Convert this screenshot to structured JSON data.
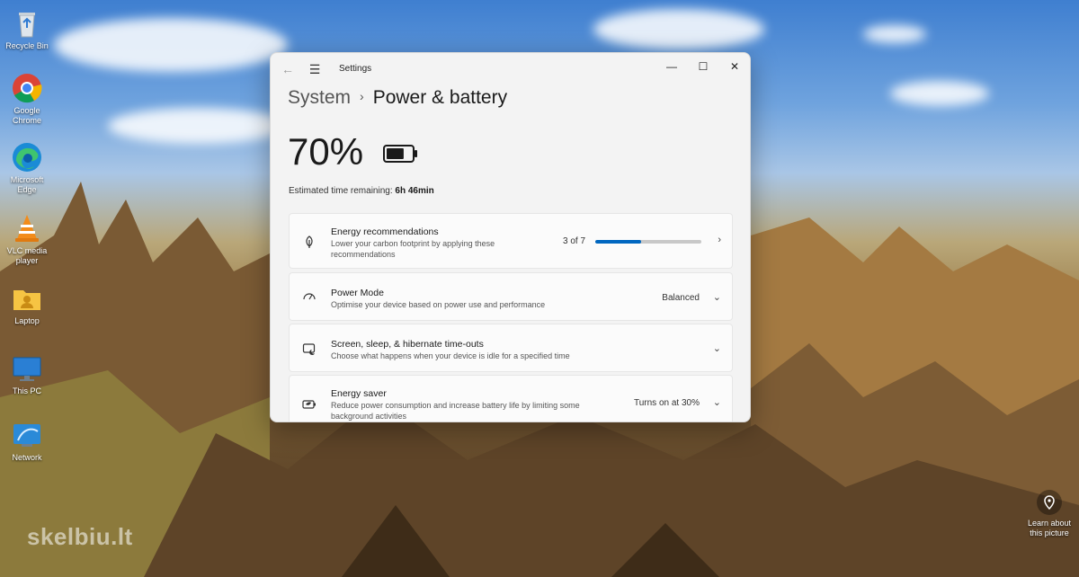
{
  "desktop": {
    "icons": [
      {
        "label": "Recycle Bin",
        "icon": "recycle-bin-icon"
      },
      {
        "label": "Google Chrome",
        "icon": "chrome-icon"
      },
      {
        "label": "Microsoft Edge",
        "icon": "edge-icon"
      },
      {
        "label": "VLC media player",
        "icon": "vlc-icon"
      },
      {
        "label": "Laptop",
        "icon": "user-folder-icon"
      },
      {
        "label": "This PC",
        "icon": "monitor-icon"
      },
      {
        "label": "Network",
        "icon": "network-icon"
      }
    ],
    "learn_label": "Learn about this picture",
    "watermark": "skelbiu.lt"
  },
  "window": {
    "app_title": "Settings",
    "breadcrumb": {
      "parent": "System",
      "separator": "›",
      "current": "Power & battery"
    },
    "battery": {
      "percent_text": "70%",
      "level": 0.7
    },
    "estimate": {
      "label": "Estimated time remaining:",
      "value": "6h 46min"
    },
    "cards": {
      "energy_recommendations": {
        "title": "Energy recommendations",
        "subtitle": "Lower your carbon footprint by applying these recommendations",
        "progress_text": "3 of 7",
        "progress_fraction": 0.43
      },
      "power_mode": {
        "title": "Power Mode",
        "subtitle": "Optimise your device based on power use and performance",
        "value": "Balanced"
      },
      "screen_sleep": {
        "title": "Screen, sleep, & hibernate time-outs",
        "subtitle": "Choose what happens when your device is idle for a specified time"
      },
      "energy_saver": {
        "title": "Energy saver",
        "subtitle": "Reduce power consumption and increase battery life by limiting some background activities",
        "value": "Turns on at 30%"
      }
    }
  },
  "colors": {
    "accent": "#0067c0"
  }
}
